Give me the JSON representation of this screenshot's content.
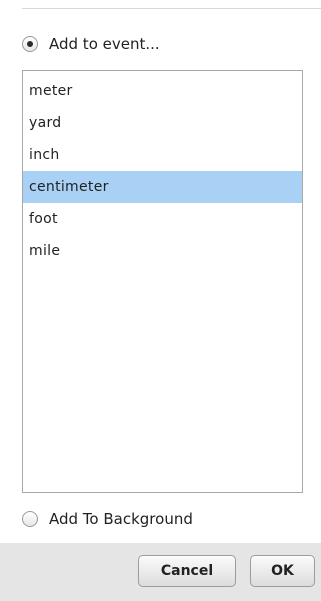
{
  "options": {
    "add_to_event": {
      "label": "Add to event...",
      "selected": true
    },
    "add_to_background": {
      "label": "Add To Background",
      "selected": false
    }
  },
  "unit_list": {
    "items": [
      "meter",
      "yard",
      "inch",
      "centimeter",
      "foot",
      "mile"
    ],
    "selected": "centimeter"
  },
  "buttons": {
    "cancel_label": "Cancel",
    "ok_label": "OK"
  },
  "colors": {
    "selection": "#a9d1f5",
    "button_bar": "#e5e5e5"
  }
}
